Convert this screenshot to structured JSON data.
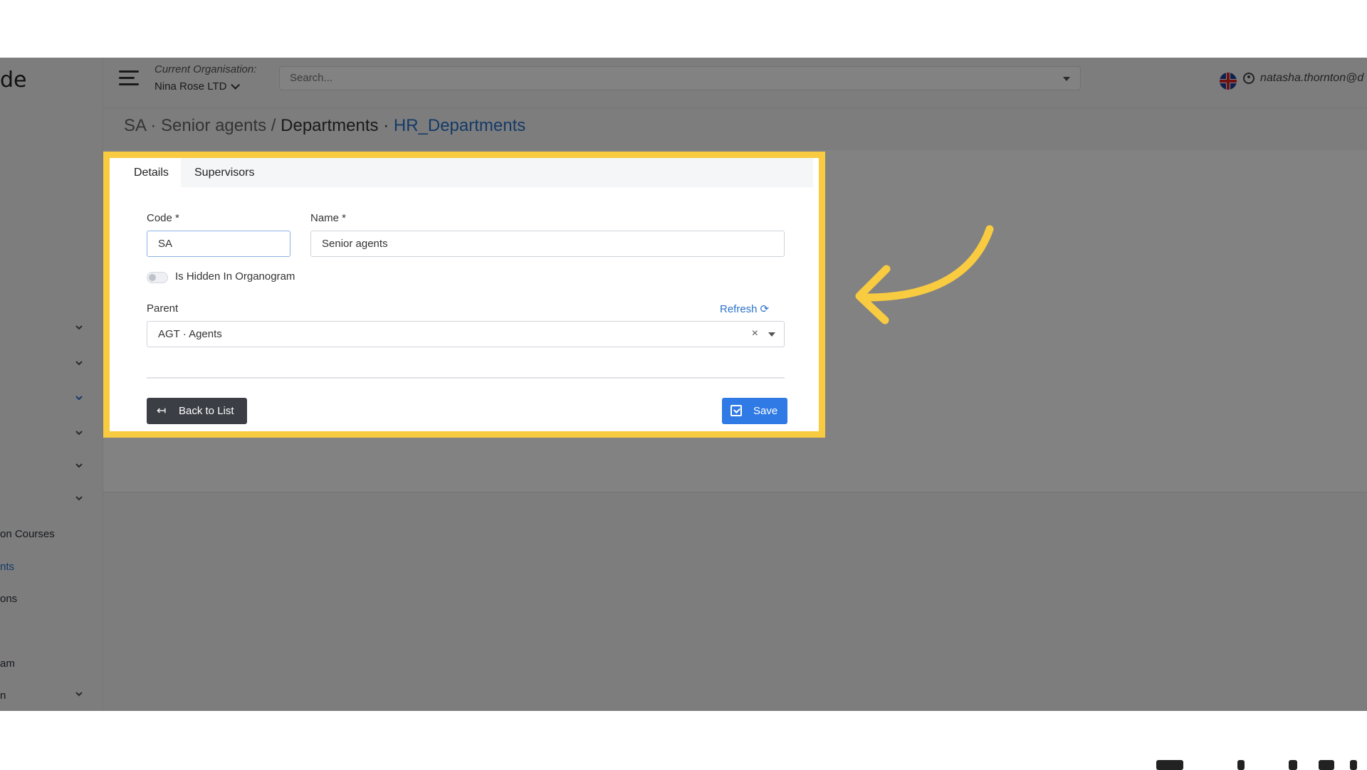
{
  "sidebar": {
    "logo_text": "de",
    "items": [
      {
        "label": ""
      },
      {
        "label": ""
      },
      {
        "label": ""
      },
      {
        "label": ""
      },
      {
        "label": ""
      },
      {
        "label": ""
      },
      {
        "label": "on Courses"
      },
      {
        "label": "nts"
      },
      {
        "label": "ons"
      },
      {
        "label": "am"
      },
      {
        "label": "n"
      }
    ]
  },
  "header": {
    "org_label": "Current Organisation:",
    "org_value": "Nina Rose LTD",
    "search_placeholder": "Search...",
    "user_email": "natasha.thornton@d"
  },
  "breadcrumb": {
    "part1": "SA · Senior agents /",
    "part2": " Departments ·",
    "part3": " HR_Departments"
  },
  "form": {
    "tabs": [
      {
        "label": "Details"
      },
      {
        "label": "Supervisors"
      }
    ],
    "code_label": "Code *",
    "code_value": "SA",
    "name_label": "Name *",
    "name_value": "Senior agents",
    "hidden_label": "Is Hidden In Organogram",
    "parent_label": "Parent",
    "refresh_label": "Refresh",
    "parent_value": "AGT · Agents",
    "clear_symbol": "×",
    "back_label": "Back to List",
    "save_label": "Save"
  },
  "colors": {
    "highlight": "#f9cb40",
    "accent": "#2a72c9",
    "save_button": "#2f7ae5",
    "back_button": "#3b3e44"
  },
  "icons": [
    "hamburger-icon",
    "chevron-down-icon",
    "flag-uk-icon",
    "user-icon",
    "refresh-icon",
    "back-icon",
    "save-icon",
    "arrow-annotation"
  ]
}
